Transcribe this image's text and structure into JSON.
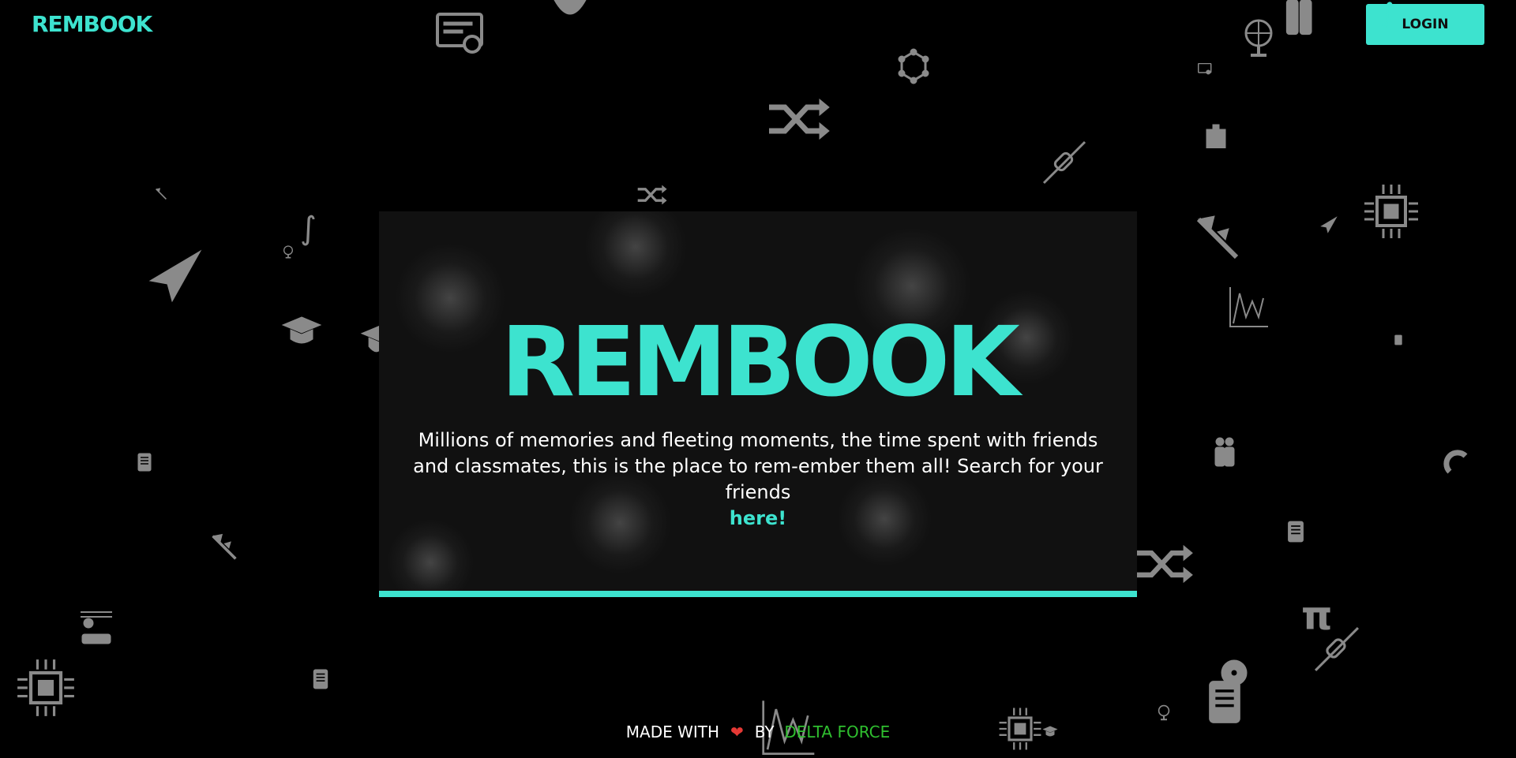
{
  "navbar": {
    "brand": "REMBOOK",
    "login_label": "LOGIN"
  },
  "hero": {
    "title": "REMBOOK",
    "text": "Millions of memories and fleeting moments, the time spent with friends and classmates, this is the place to rem-ember them all! Search for your friends",
    "link_label": "here!"
  },
  "footer": {
    "made_with": "MADE WITH",
    "by": "BY",
    "team": "DELTA FORCE",
    "heart_icon": "heart-icon"
  },
  "colors": {
    "accent": "#3de3cf",
    "background": "#000000",
    "card": "#111111",
    "icon": "#8a8a8a",
    "heart": "#e53935",
    "team": "#2fbf2f"
  },
  "background_icons": [
    "certificate-icon",
    "shuffle-icon",
    "molecule-icon",
    "resistor-icon",
    "chip-icon",
    "paper-plane-icon",
    "graduation-cap-icon",
    "caliper-icon",
    "integral-icon",
    "globe-icon",
    "notebook-icon",
    "pi-icon",
    "magnet-icon",
    "chart-icon",
    "people-icon",
    "radiation-icon",
    "building-icon"
  ]
}
